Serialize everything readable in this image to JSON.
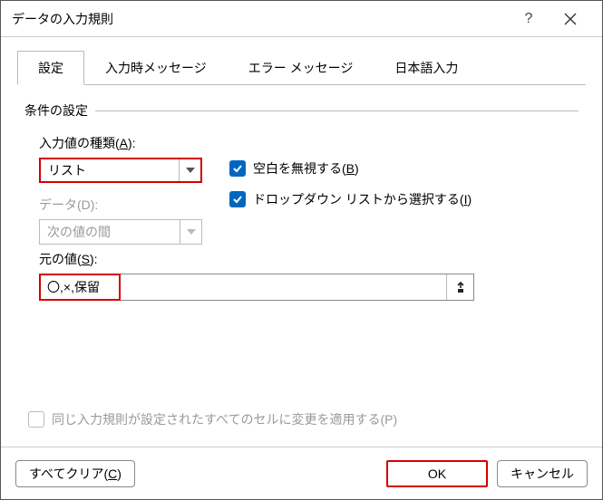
{
  "title": "データの入力規則",
  "tabs": [
    {
      "label": "設定"
    },
    {
      "label": "入力時メッセージ"
    },
    {
      "label": "エラー メッセージ"
    },
    {
      "label": "日本語入力"
    }
  ],
  "fieldset_title": "条件の設定",
  "allow": {
    "label_pre": "入力値の種類(",
    "label_key": "A",
    "label_post": "):",
    "value": "リスト"
  },
  "data": {
    "label": "データ(D):",
    "value": "次の値の間"
  },
  "ignore_blank": {
    "label_pre": "空白を無視する(",
    "label_key": "B",
    "label_post": ")"
  },
  "in_cell_dropdown": {
    "label_pre": "ドロップダウン リストから選択する(",
    "label_key": "I",
    "label_post": ")"
  },
  "source": {
    "label_pre": "元の値(",
    "label_key": "S",
    "label_post": "):",
    "value": "〇,×,保留"
  },
  "apply_all": "同じ入力規則が設定されたすべてのセルに変更を適用する(P)",
  "buttons": {
    "clear_pre": "すべてクリア(",
    "clear_key": "C",
    "clear_post": ")",
    "ok": "OK",
    "cancel": "キャンセル"
  }
}
